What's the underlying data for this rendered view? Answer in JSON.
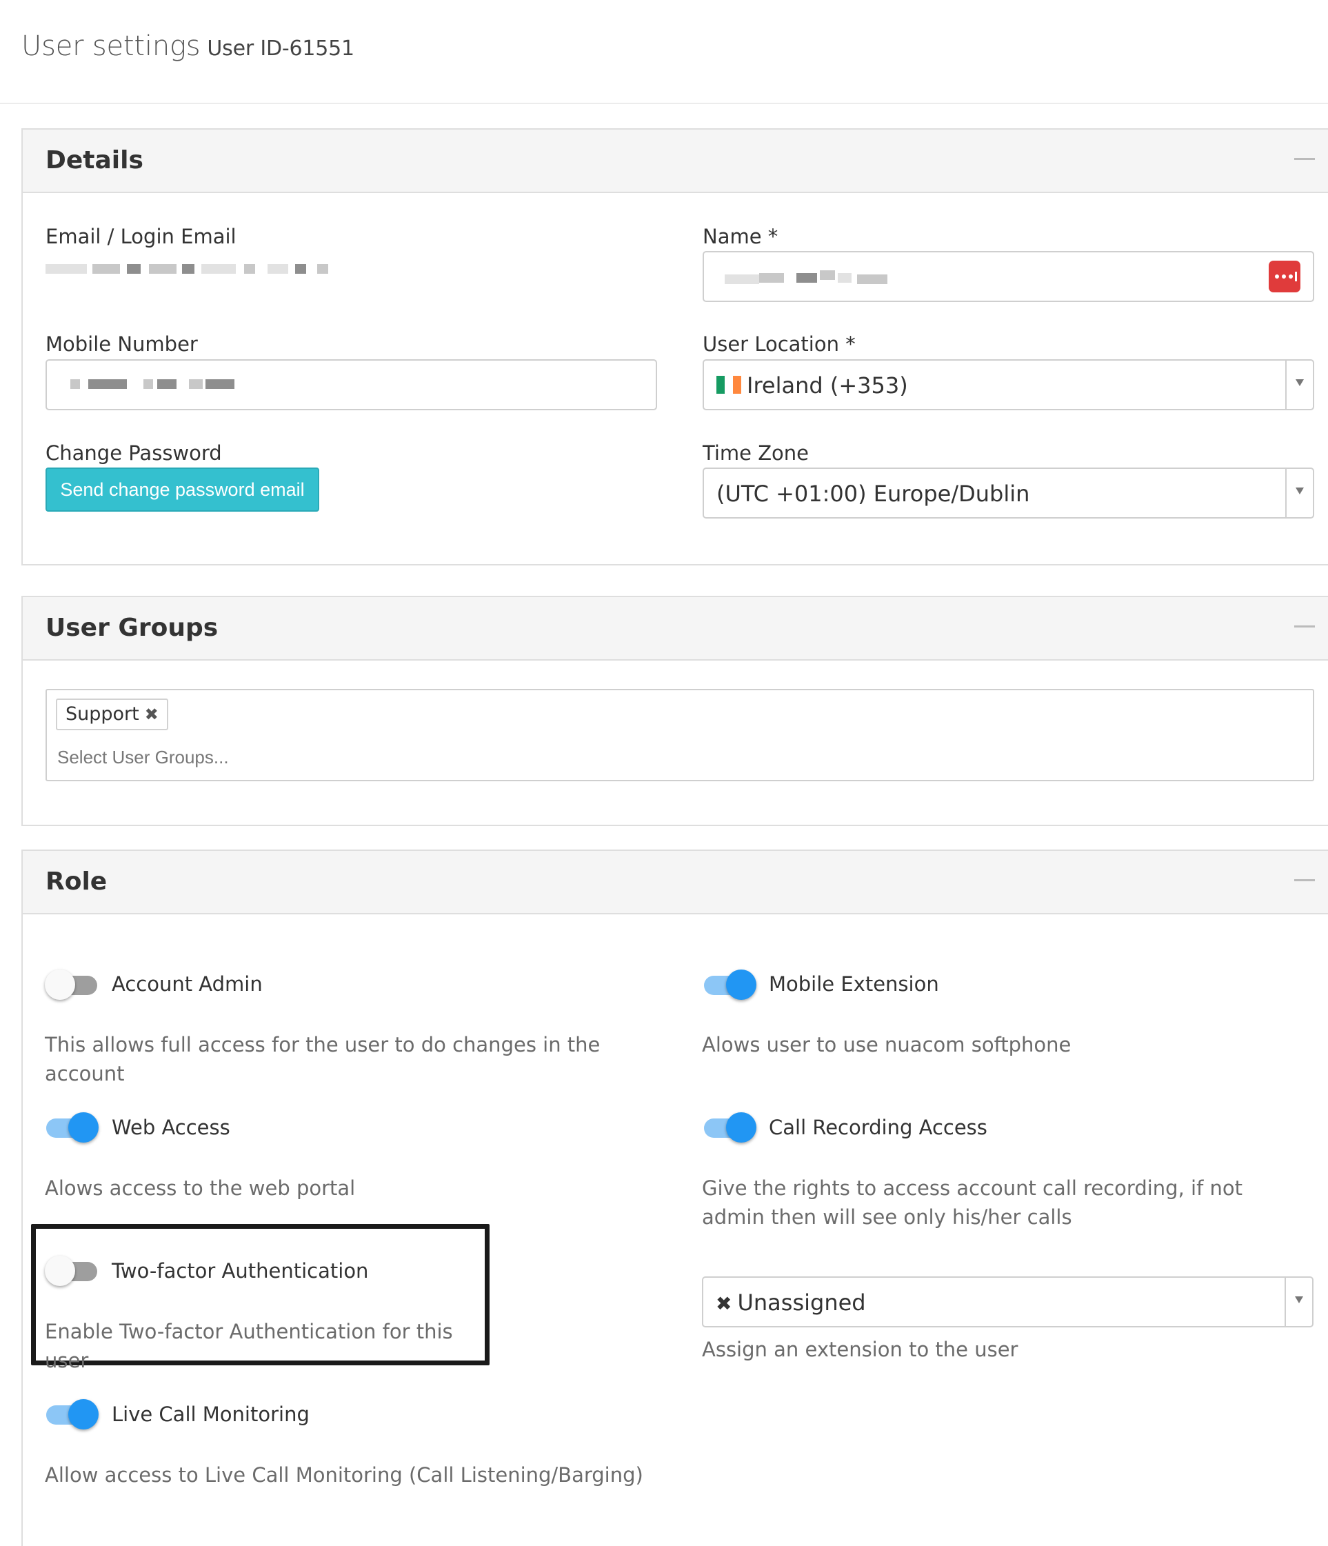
{
  "header": {
    "title": "User settings",
    "subtitle": "User ID-61551"
  },
  "details": {
    "title": "Details",
    "email_label": "Email / Login Email",
    "name_label": "Name *",
    "mobile_label": "Mobile Number",
    "location_label": "User Location *",
    "location_value": "Ireland (+353)",
    "password_label": "Change Password",
    "password_button": "Send change password email",
    "timezone_label": "Time Zone",
    "timezone_value": "(UTC +01:00) Europe/Dublin",
    "password_manager_icon": "dots-icon"
  },
  "user_groups": {
    "title": "User Groups",
    "tags": [
      "Support"
    ],
    "placeholder": "Select User Groups..."
  },
  "role": {
    "title": "Role",
    "toggles": [
      {
        "label": "Account Admin",
        "on": false,
        "description": "This allows full access for the user to do changes in the account"
      },
      {
        "label": "Mobile Extension",
        "on": true,
        "description": "Alows user to use nuacom softphone"
      },
      {
        "label": "Web Access",
        "on": true,
        "description": "Alows access to the web portal"
      },
      {
        "label": "Call Recording Access",
        "on": true,
        "description": "Give the rights to access account call recording, if not admin then will see only his/her calls"
      },
      {
        "label": "Two-factor Authentication",
        "on": false,
        "description": "Enable Two-factor Authentication for this user"
      },
      {
        "label": "Live Call Monitoring",
        "on": true,
        "description": "Allow access to Live Call Monitoring (Call Listening/Barging)"
      }
    ],
    "extension_value": "Unassigned",
    "extension_description": "Assign an extension to the user"
  },
  "colors": {
    "primary_button": "#34c0cf",
    "toggle_on": "#2196f3",
    "toggle_on_track": "#8cc6f6",
    "password_manager": "#e03b3b"
  }
}
